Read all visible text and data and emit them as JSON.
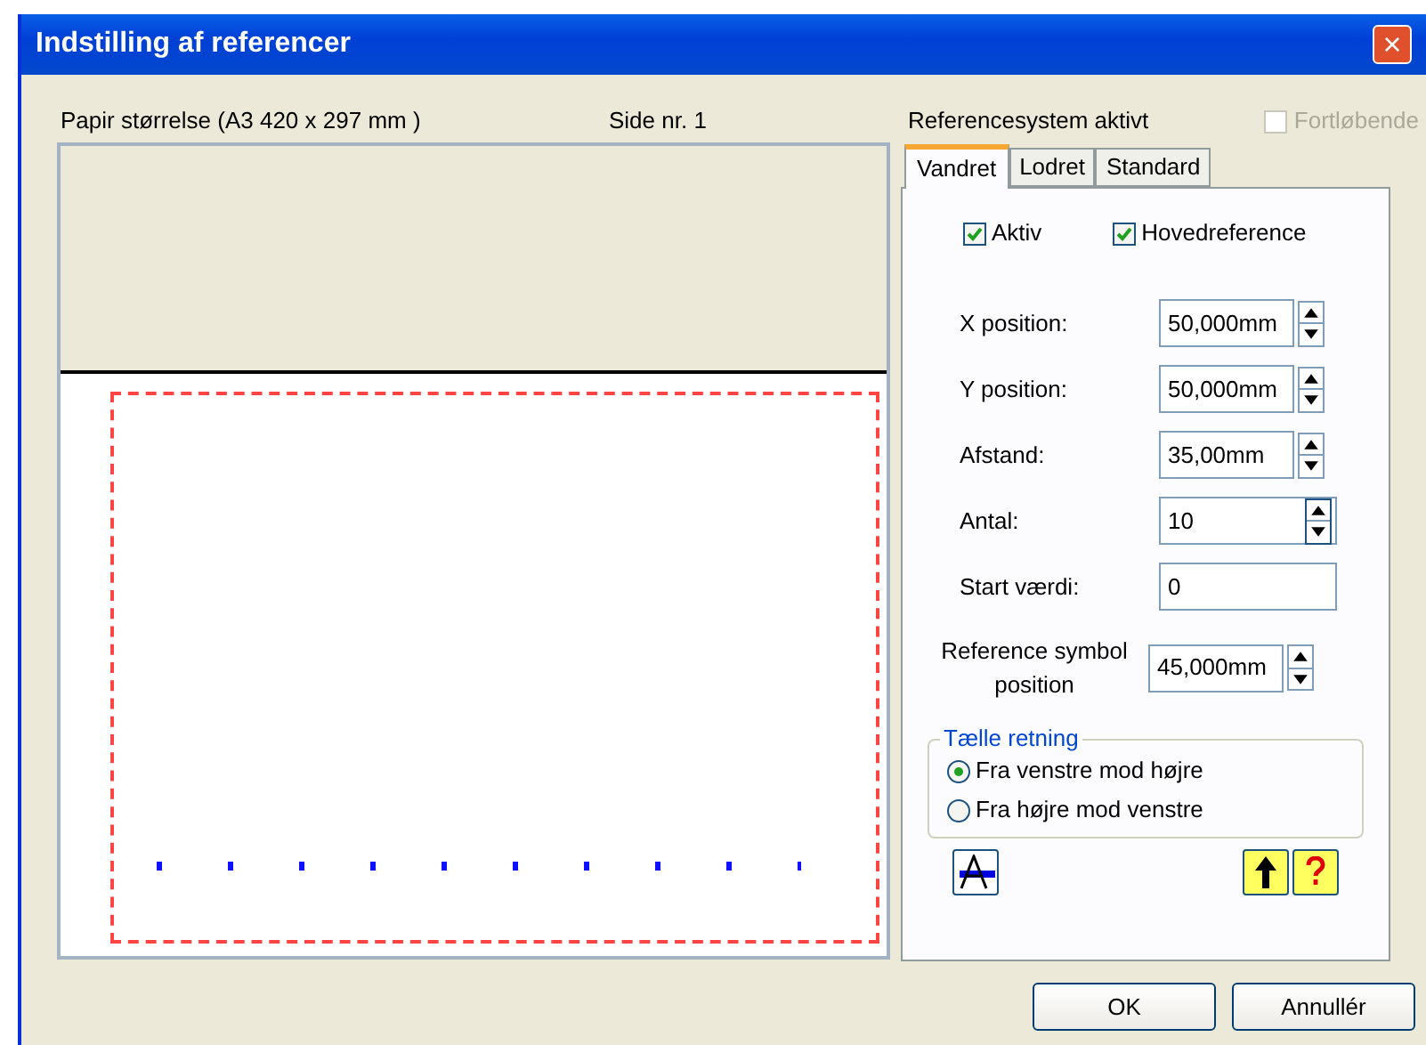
{
  "window": {
    "title": "Indstilling af referencer",
    "close": "×"
  },
  "preview": {
    "paper_label": "Papir størrelse (A3  420 x 297 mm )",
    "page_label": "Side nr. 1"
  },
  "reference_system": {
    "label": "Referencesystem aktivt",
    "continuous": {
      "label": "Fortløbende",
      "checked": false,
      "disabled": true
    }
  },
  "tabs": [
    {
      "label": "Vandret",
      "selected": true
    },
    {
      "label": "Lodret",
      "selected": false
    },
    {
      "label": "Standard",
      "selected": false
    }
  ],
  "checkboxes": [
    {
      "label": "Aktiv",
      "checked": true
    },
    {
      "label": "Hovedreference",
      "checked": true
    }
  ],
  "fields": [
    {
      "label": "X position:",
      "value": "50,000mm",
      "kind": "spin"
    },
    {
      "label": "Y position:",
      "value": "50,000mm",
      "kind": "spin"
    },
    {
      "label": "Afstand:",
      "value": "35,00mm",
      "kind": "spin"
    },
    {
      "label": "Antal:",
      "value": "10",
      "kind": "spinwide"
    },
    {
      "label": "Start værdi:",
      "value": "0",
      "kind": "text"
    },
    {
      "label": "Reference symbol position",
      "value": "45,000mm",
      "kind": "spin"
    }
  ],
  "direction": {
    "title": "Tælle retning",
    "options": [
      {
        "label": "Fra venstre mod højre",
        "selected": true
      },
      {
        "label": "Fra højre mod venstre",
        "selected": false
      }
    ]
  },
  "buttons": [
    "OK",
    "Annullér"
  ]
}
